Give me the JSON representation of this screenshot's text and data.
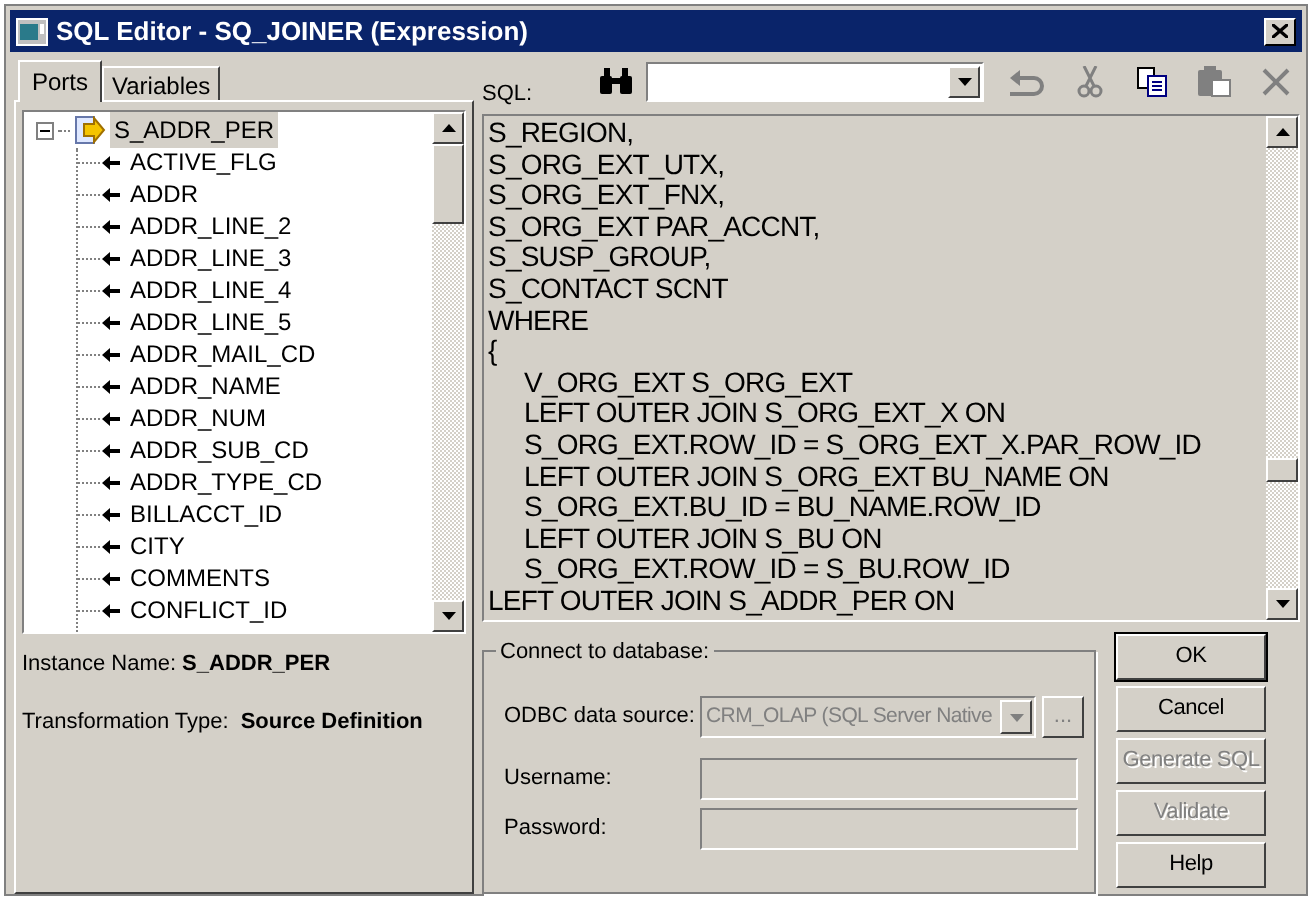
{
  "window": {
    "title": "SQL Editor - SQ_JOINER (Expression)"
  },
  "tabs": [
    {
      "label": "Ports",
      "selected": true
    },
    {
      "label": "Variables",
      "selected": false
    }
  ],
  "tree": {
    "label": "S_ADDR_PER",
    "expanded": true,
    "selected": true,
    "children": [
      {
        "label": "ACTIVE_FLG",
        "selected": false
      },
      {
        "label": "ADDR",
        "selected": false
      },
      {
        "label": "ADDR_LINE_2",
        "selected": false
      },
      {
        "label": "ADDR_LINE_3",
        "selected": false
      },
      {
        "label": "ADDR_LINE_4",
        "selected": false
      },
      {
        "label": "ADDR_LINE_5",
        "selected": false
      },
      {
        "label": "ADDR_MAIL_CD",
        "selected": false
      },
      {
        "label": "ADDR_NAME",
        "selected": false
      },
      {
        "label": "ADDR_NUM",
        "selected": false
      },
      {
        "label": "ADDR_SUB_CD",
        "selected": false
      },
      {
        "label": "ADDR_TYPE_CD",
        "selected": false
      },
      {
        "label": "BILLACCT_ID",
        "selected": false
      },
      {
        "label": "CITY",
        "selected": false
      },
      {
        "label": "COMMENTS",
        "selected": false
      },
      {
        "label": "CONFLICT_ID",
        "selected": false
      }
    ]
  },
  "instance_name": {
    "label": "Instance Name:",
    "value": "S_ADDR_PER"
  },
  "transformation_type": {
    "label": "Transformation Type:",
    "value": "Source Definition"
  },
  "sql": {
    "label": "SQL:",
    "lines": [
      {
        "text": "S_REGION,",
        "indented": false
      },
      {
        "text": "S_ORG_EXT_UTX,",
        "indented": false
      },
      {
        "text": "S_ORG_EXT_FNX,",
        "indented": false
      },
      {
        "text": "S_ORG_EXT PAR_ACCNT,",
        "indented": false
      },
      {
        "text": "S_SUSP_GROUP,",
        "indented": false
      },
      {
        "text": "S_CONTACT SCNT",
        "indented": false
      },
      {
        "text": "WHERE",
        "indented": false
      },
      {
        "text": "{",
        "indented": false
      },
      {
        "text": "V_ORG_EXT S_ORG_EXT",
        "indented": true
      },
      {
        "text": "LEFT OUTER JOIN S_ORG_EXT_X ON",
        "indented": true
      },
      {
        "text": "S_ORG_EXT.ROW_ID = S_ORG_EXT_X.PAR_ROW_ID",
        "indented": true
      },
      {
        "text": "LEFT OUTER JOIN S_ORG_EXT BU_NAME ON",
        "indented": true
      },
      {
        "text": "S_ORG_EXT.BU_ID = BU_NAME.ROW_ID",
        "indented": true
      },
      {
        "text": "LEFT OUTER JOIN S_BU ON",
        "indented": true
      },
      {
        "text": "S_ORG_EXT.ROW_ID = S_BU.ROW_ID",
        "indented": true
      },
      {
        "text": "LEFT OUTER JOIN S_ADDR_PER ON",
        "indented": false
      }
    ]
  },
  "toolbar": [
    {
      "kind": "undo",
      "disabled": true
    },
    {
      "kind": "cut",
      "disabled": true
    },
    {
      "kind": "copy",
      "disabled": false
    },
    {
      "kind": "paste",
      "disabled": true
    },
    {
      "kind": "delete",
      "disabled": true
    }
  ],
  "connect": {
    "title": "Connect to database:",
    "odbc_label": "ODBC data source:",
    "odbc_value": "CRM_OLAP (SQL Server Native",
    "odbc_disabled": true,
    "browse_label": "...",
    "username_label": "Username:",
    "password_label": "Password:",
    "fields_disabled": true
  },
  "buttons": [
    {
      "label": "OK",
      "disabled": false,
      "default": true
    },
    {
      "label": "Cancel",
      "disabled": false,
      "default": false
    },
    {
      "label": "Generate SQL",
      "disabled": true,
      "default": false
    },
    {
      "label": "Validate",
      "disabled": true,
      "default": false
    },
    {
      "label": "Help",
      "disabled": false,
      "default": false
    }
  ]
}
